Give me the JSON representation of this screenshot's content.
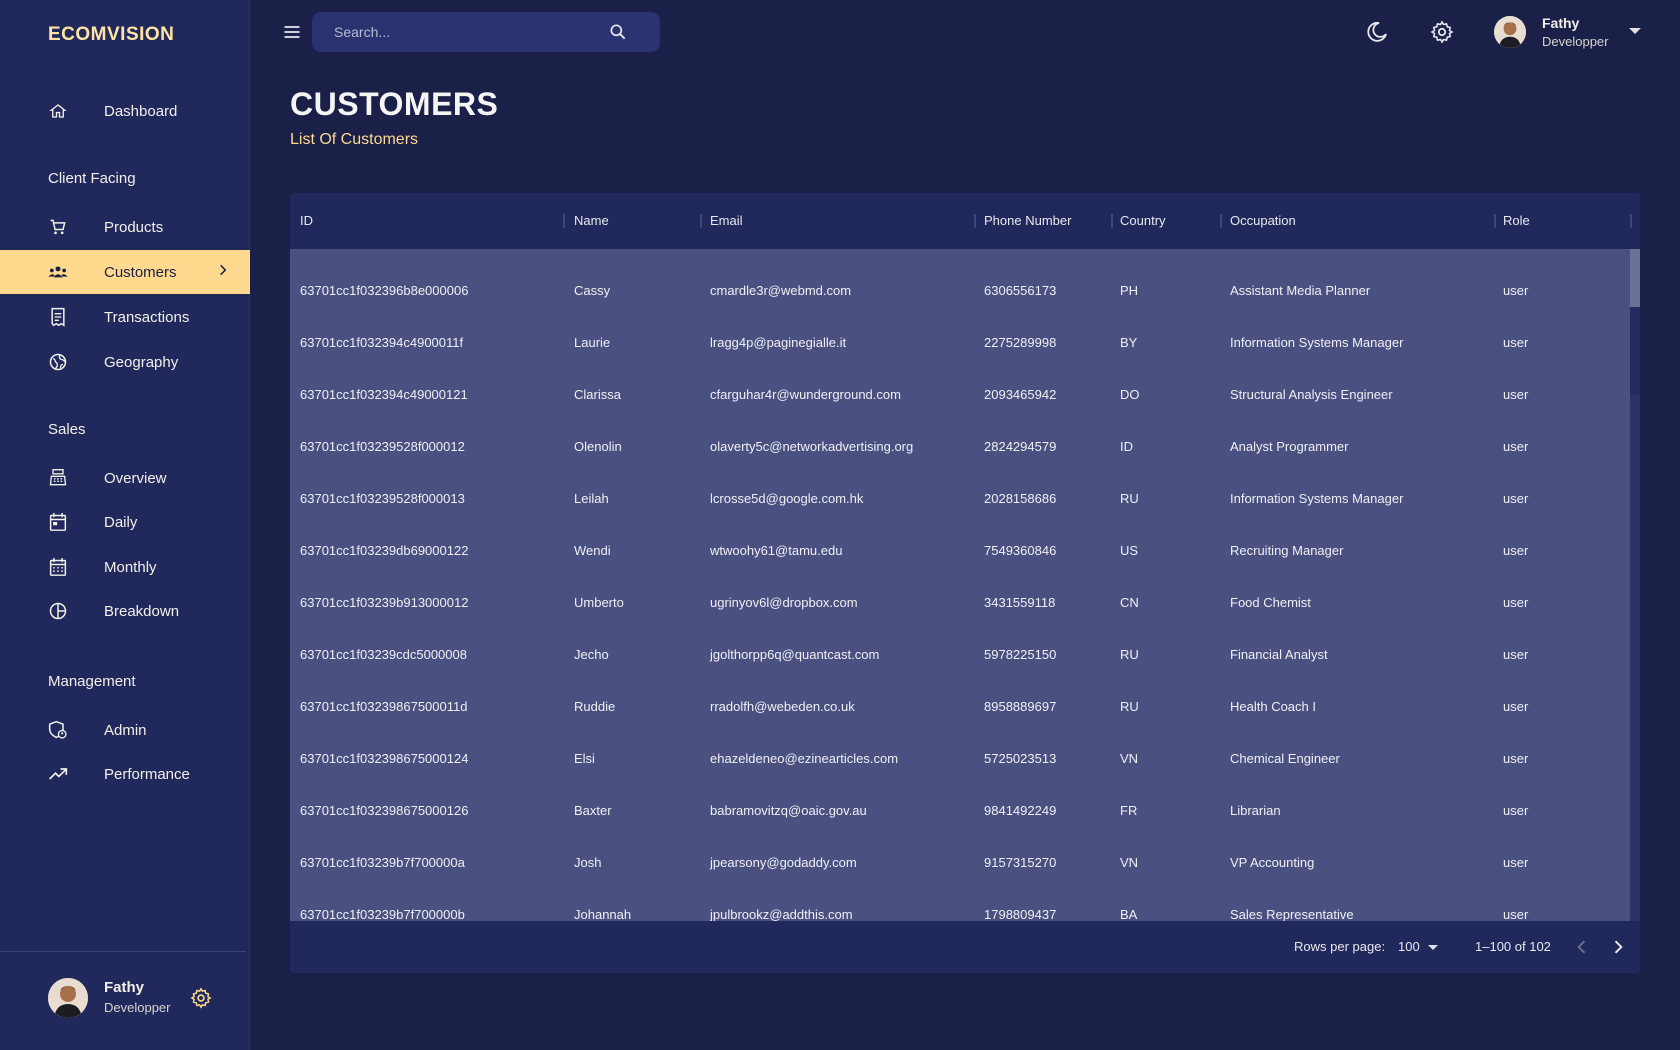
{
  "brand": "ECOMVISION",
  "sidebar": {
    "items": [
      {
        "label": "Dashboard",
        "icon": "home-icon"
      },
      {
        "label": "Products",
        "icon": "cart-icon"
      },
      {
        "label": "Customers",
        "icon": "groups-icon",
        "active": true
      },
      {
        "label": "Transactions",
        "icon": "receipt-icon"
      },
      {
        "label": "Geography",
        "icon": "globe-icon"
      },
      {
        "label": "Overview",
        "icon": "point-of-sale-icon"
      },
      {
        "label": "Daily",
        "icon": "calendar-today-icon"
      },
      {
        "label": "Monthly",
        "icon": "calendar-month-icon"
      },
      {
        "label": "Breakdown",
        "icon": "pie-chart-icon"
      },
      {
        "label": "Admin",
        "icon": "admin-icon"
      },
      {
        "label": "Performance",
        "icon": "trending-up-icon"
      }
    ],
    "sections": [
      "Client Facing",
      "Sales",
      "Management"
    ],
    "user": {
      "name": "Fathy",
      "role": "Developper"
    }
  },
  "topbar": {
    "search_placeholder": "Search...",
    "user": {
      "name": "Fathy",
      "role": "Developper"
    }
  },
  "header": {
    "title": "CUSTOMERS",
    "subtitle": "List Of Customers"
  },
  "table": {
    "columns": [
      "ID",
      "Name",
      "Email",
      "Phone Number",
      "Country",
      "Occupation",
      "Role"
    ],
    "rows": [
      [
        "63701cc1f032396b8e000006",
        "Cassy",
        "cmardle3r@webmd.com",
        "6306556173",
        "PH",
        "Assistant Media Planner",
        "user"
      ],
      [
        "63701cc1f032394c4900011f",
        "Laurie",
        "lragg4p@paginegialle.it",
        "2275289998",
        "BY",
        "Information Systems Manager",
        "user"
      ],
      [
        "63701cc1f032394c49000121",
        "Clarissa",
        "cfarguhar4r@wunderground.com",
        "2093465942",
        "DO",
        "Structural Analysis Engineer",
        "user"
      ],
      [
        "63701cc1f03239528f000012",
        "Olenolin",
        "olaverty5c@networkadvertising.org",
        "2824294579",
        "ID",
        "Analyst Programmer",
        "user"
      ],
      [
        "63701cc1f03239528f000013",
        "Leilah",
        "lcrosse5d@google.com.hk",
        "2028158686",
        "RU",
        "Information Systems Manager",
        "user"
      ],
      [
        "63701cc1f03239db69000122",
        "Wendi",
        "wtwoohy61@tamu.edu",
        "7549360846",
        "US",
        "Recruiting Manager",
        "user"
      ],
      [
        "63701cc1f03239b913000012",
        "Umberto",
        "ugrinyov6l@dropbox.com",
        "3431559118",
        "CN",
        "Food Chemist",
        "user"
      ],
      [
        "63701cc1f03239cdc5000008",
        "Jecho",
        "jgolthorpp6q@quantcast.com",
        "5978225150",
        "RU",
        "Financial Analyst",
        "user"
      ],
      [
        "63701cc1f03239867500011d",
        "Ruddie",
        "rradolfh@webeden.co.uk",
        "8958889697",
        "RU",
        "Health Coach I",
        "user"
      ],
      [
        "63701cc1f032398675000124",
        "Elsi",
        "ehazeldeneo@ezinearticles.com",
        "5725023513",
        "VN",
        "Chemical Engineer",
        "user"
      ],
      [
        "63701cc1f032398675000126",
        "Baxter",
        "babramovitzq@oaic.gov.au",
        "9841492249",
        "FR",
        "Librarian",
        "user"
      ],
      [
        "63701cc1f03239b7f700000a",
        "Josh",
        "jpearsony@godaddy.com",
        "9157315270",
        "VN",
        "VP Accounting",
        "user"
      ],
      [
        "63701cc1f03239b7f700000b",
        "Johannah",
        "jpulbrookz@addthis.com",
        "1798809437",
        "BA",
        "Sales Representative",
        "user"
      ]
    ]
  },
  "pagination": {
    "rows_per_page_label": "Rows per page:",
    "rows_per_page": "100",
    "range": "1–100 of 102"
  },
  "colors": {
    "background": "#1b2048",
    "sidebar": "#21295c",
    "accent": "#ffd98e",
    "table_body": "#4a5080"
  }
}
